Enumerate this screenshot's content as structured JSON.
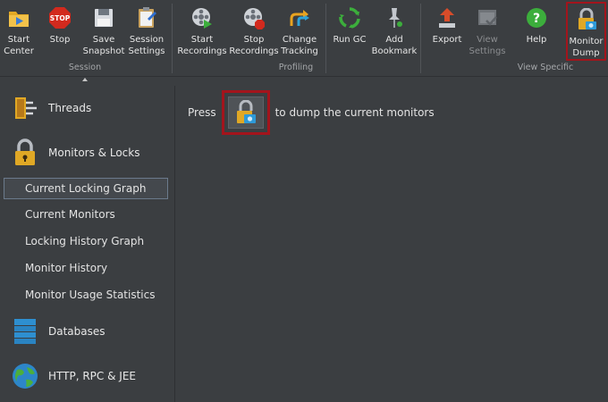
{
  "toolbar": {
    "buttons": [
      {
        "label": "Start\nCenter",
        "icon": "folder-play-icon"
      },
      {
        "label": "Stop",
        "icon": "stop-sign-icon"
      },
      {
        "label": "Save\nSnapshot",
        "icon": "floppy-disk-icon"
      },
      {
        "label": "Session\nSettings",
        "icon": "clipboard-settings-icon"
      },
      {
        "label": "Start\nRecordings",
        "icon": "film-reel-play-icon"
      },
      {
        "label": "Stop\nRecordings",
        "icon": "film-reel-stop-icon"
      },
      {
        "label": "Change\nTracking",
        "icon": "split-arrow-icon"
      },
      {
        "label": "Run GC",
        "icon": "recycle-icon"
      },
      {
        "label": "Add\nBookmark",
        "icon": "bookmark-pin-icon"
      },
      {
        "label": "Export",
        "icon": "export-arrow-icon"
      },
      {
        "label": "View\nSettings",
        "icon": "view-settings-icon"
      },
      {
        "label": "Help",
        "icon": "help-icon"
      },
      {
        "label": "Monitor\nDump",
        "icon": "lock-camera-icon"
      }
    ],
    "groups": {
      "session": "Session",
      "profiling": "Profiling",
      "view_specific": "View Specific"
    }
  },
  "sidebar": {
    "categories": [
      {
        "label": "Threads",
        "icon": "threads-icon"
      },
      {
        "label": "Monitors & Locks",
        "icon": "padlock-icon"
      },
      {
        "label": "Databases",
        "icon": "database-icon"
      },
      {
        "label": "HTTP, RPC & JEE",
        "icon": "globe-icon"
      }
    ],
    "items": [
      {
        "label": "Current Locking Graph",
        "selected": true
      },
      {
        "label": "Current Monitors"
      },
      {
        "label": "Locking History Graph"
      },
      {
        "label": "Monitor History"
      },
      {
        "label": "Monitor Usage Statistics"
      }
    ]
  },
  "main": {
    "hint_prefix": "Press",
    "hint_suffix": "to dump the current monitors"
  },
  "colors": {
    "background": "#3b3e41",
    "highlight_border": "#a3141c",
    "selected_item_border": "#6b7a8c"
  }
}
